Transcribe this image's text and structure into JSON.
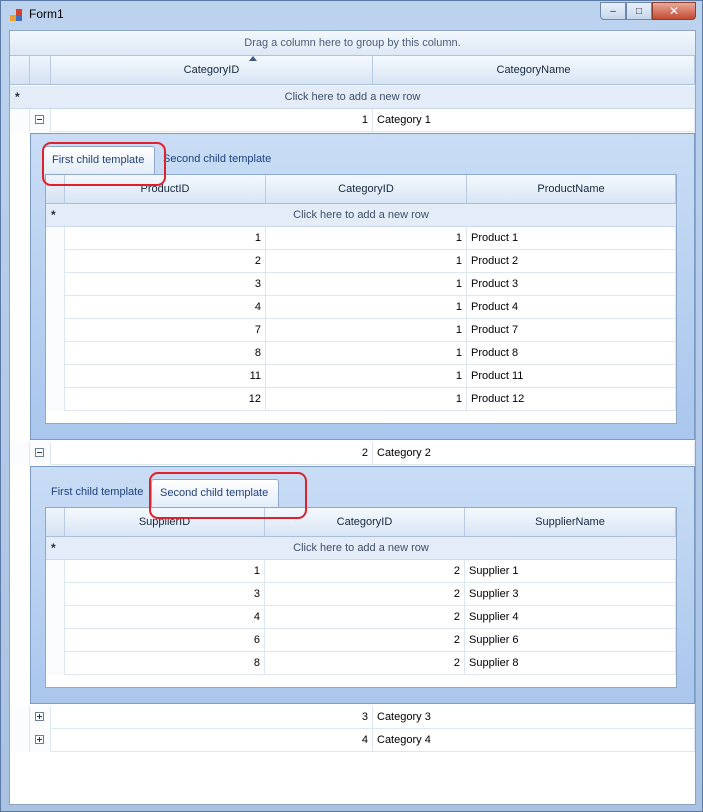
{
  "window": {
    "title": "Form1",
    "buttons": {
      "minimize": "–",
      "maximize": "□",
      "close": "✕"
    }
  },
  "group_panel": {
    "text": "Drag a column here to group by this column."
  },
  "master": {
    "columns": [
      "CategoryID",
      "CategoryName"
    ],
    "new_row_text": "Click here to add a new row",
    "rows": [
      {
        "id": "1",
        "name": "Category 1",
        "expanded": true
      },
      {
        "id": "2",
        "name": "Category 2",
        "expanded": true
      },
      {
        "id": "3",
        "name": "Category 3",
        "expanded": false
      },
      {
        "id": "4",
        "name": "Category 4",
        "expanded": false
      }
    ]
  },
  "detail1": {
    "tabs": [
      "First child template",
      "Second child template"
    ],
    "active_tab": "First child template",
    "columns": [
      "ProductID",
      "CategoryID",
      "ProductName"
    ],
    "new_row_text": "Click here to add a new row",
    "rows": [
      [
        "1",
        "1",
        "Product 1"
      ],
      [
        "2",
        "1",
        "Product 2"
      ],
      [
        "3",
        "1",
        "Product 3"
      ],
      [
        "4",
        "1",
        "Product 4"
      ],
      [
        "7",
        "1",
        "Product 7"
      ],
      [
        "8",
        "1",
        "Product 8"
      ],
      [
        "11",
        "1",
        "Product 11"
      ],
      [
        "12",
        "1",
        "Product 12"
      ]
    ]
  },
  "detail2": {
    "tabs": [
      "First child template",
      "Second child template"
    ],
    "active_tab": "Second child template",
    "columns": [
      "SupplierID",
      "CategoryID",
      "SupplierName"
    ],
    "new_row_text": "Click here to add a new row",
    "rows": [
      [
        "1",
        "2",
        "Supplier 1"
      ],
      [
        "3",
        "2",
        "Supplier 3"
      ],
      [
        "4",
        "2",
        "Supplier 4"
      ],
      [
        "6",
        "2",
        "Supplier 6"
      ],
      [
        "8",
        "2",
        "Supplier 8"
      ]
    ]
  },
  "colors": {
    "highlight": "#e0202a",
    "tab_text": "#1f3f80"
  }
}
